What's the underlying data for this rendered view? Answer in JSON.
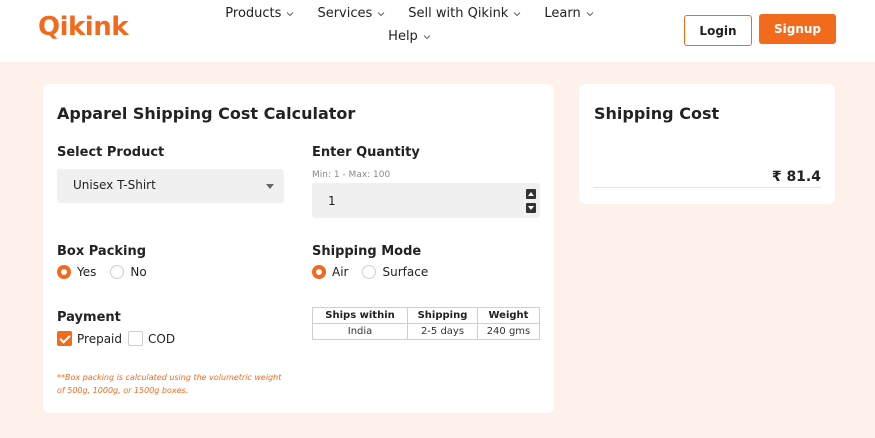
{
  "header": {
    "logo": "Qikink",
    "nav": [
      {
        "label": "Products"
      },
      {
        "label": "Services"
      },
      {
        "label": "Sell with Qikink"
      },
      {
        "label": "Learn"
      },
      {
        "label": "Help"
      }
    ],
    "login_label": "Login",
    "signup_label": "Signup"
  },
  "calculator": {
    "title": "Apparel Shipping Cost Calculator",
    "product_label": "Select Product",
    "product_value": "Unisex T-Shirt",
    "quantity_label": "Enter Quantity",
    "quantity_hint": "Min: 1 - Max: 100",
    "quantity_value": "1",
    "box_packing_label": "Box Packing",
    "box_packing_options": [
      "Yes",
      "No"
    ],
    "box_packing_selected": "Yes",
    "shipping_mode_label": "Shipping Mode",
    "shipping_mode_options": [
      "Air",
      "Surface"
    ],
    "shipping_mode_selected": "Air",
    "payment_label": "Payment",
    "payment_options": [
      "Prepaid",
      "COD"
    ],
    "payment_checked": [
      "Prepaid"
    ],
    "table": {
      "headers": [
        "Ships within",
        "Shipping",
        "Weight"
      ],
      "row": [
        "India",
        "2-5 days",
        "240 gms"
      ]
    },
    "note": "**Box packing is calculated using the volumetric weight of 500g, 1000g, or 1500g boxes."
  },
  "shipping_cost": {
    "title": "Shipping Cost",
    "value": "₹ 81.4"
  },
  "colors": {
    "accent": "#f26b1d",
    "page_bg": "#fdf1ea"
  }
}
